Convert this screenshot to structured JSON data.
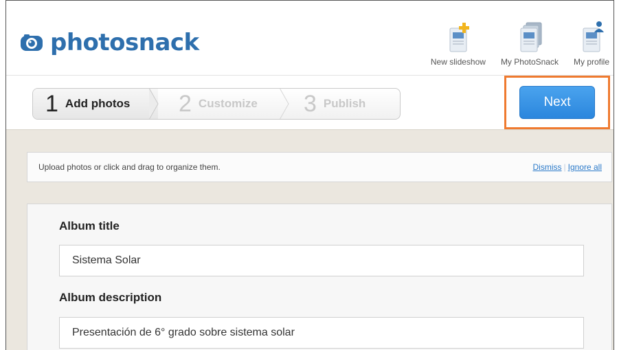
{
  "app": {
    "logo_text": "photosnack",
    "brand_color": "#2e6fad"
  },
  "topnav": [
    {
      "label": "New slideshow",
      "icon": "new-slideshow-icon"
    },
    {
      "label": "My PhotoSnack",
      "icon": "my-photosnack-icon"
    },
    {
      "label": "My profile",
      "icon": "my-profile-icon"
    }
  ],
  "steps": [
    {
      "number": "1",
      "label": "Add photos",
      "state": "active"
    },
    {
      "number": "2",
      "label": "Customize",
      "state": "inactive"
    },
    {
      "number": "3",
      "label": "Publish",
      "state": "inactive"
    }
  ],
  "next_button": {
    "label": "Next",
    "color": "#2b86dd",
    "highlight_color": "#ef7a2f"
  },
  "notice": {
    "text": "Upload photos or click and drag to organize them.",
    "dismiss": "Dismiss",
    "separator": "|",
    "ignore_all": "Ignore all"
  },
  "form": {
    "album_title_label": "Album title",
    "album_title_value": "Sistema Solar",
    "album_description_label": "Album description",
    "album_description_value": "Presentación de 6° grado sobre sistema solar"
  }
}
